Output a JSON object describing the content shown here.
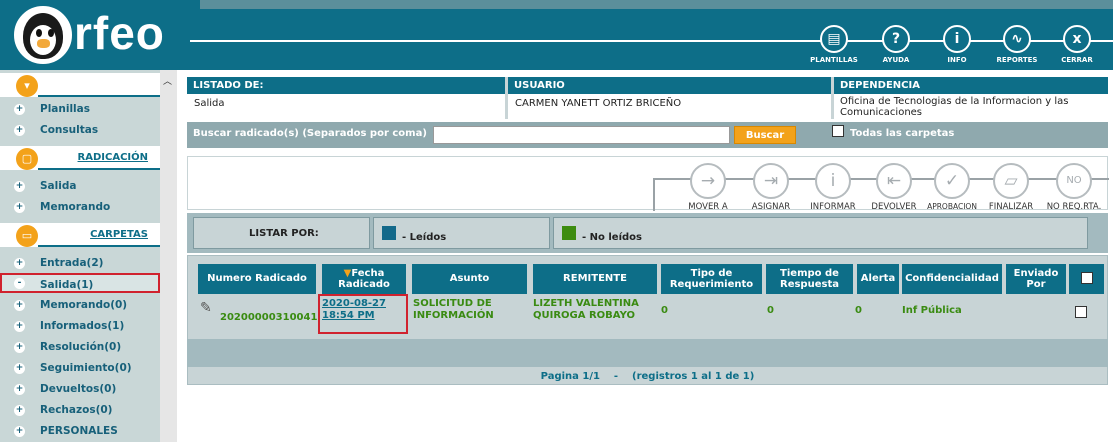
{
  "app": {
    "logo_text": "rfeo"
  },
  "header_buttons": [
    {
      "label": "PLANTILLAS",
      "glyph": "▤",
      "icon": "templates-icon"
    },
    {
      "label": "AYUDA",
      "glyph": "?",
      "icon": "help-icon"
    },
    {
      "label": "INFO",
      "glyph": "i",
      "icon": "info-icon"
    },
    {
      "label": "REPORTES",
      "glyph": "∿",
      "icon": "reports-icon"
    },
    {
      "label": "CERRAR",
      "glyph": "x",
      "icon": "close-icon"
    }
  ],
  "sidebar": {
    "top_items": [
      "Planillas",
      "Consultas"
    ],
    "radicacion_title": "RADICACIÓN",
    "radicacion_items": [
      "Salida",
      "Memorando"
    ],
    "carpetas_title": "CARPETAS",
    "carpetas_items": [
      {
        "label": "Entrada(2)",
        "sign": "+"
      },
      {
        "label": "Salida(1)",
        "sign": "-"
      },
      {
        "label": "Memorando(0)",
        "sign": "+"
      },
      {
        "label": "Informados(1)",
        "sign": "+"
      },
      {
        "label": "Resolución(0)",
        "sign": "+"
      },
      {
        "label": "Seguimiento(0)",
        "sign": "+"
      },
      {
        "label": "Devueltos(0)",
        "sign": "+"
      },
      {
        "label": "Rechazos(0)",
        "sign": "+"
      },
      {
        "label": "PERSONALES",
        "sign": "+"
      }
    ]
  },
  "info": {
    "listado_label": "LISTADO DE:",
    "listado_value": "Salida",
    "usuario_label": "USUARIO",
    "usuario_value": "CARMEN YANETT ORTIZ BRICEÑO",
    "dependencia_label": "DEPENDENCIA",
    "dependencia_value": "Oficina de Tecnologias de la Informacion y las Comunicaciones"
  },
  "search": {
    "label": "Buscar radicado(s) (Separados por coma)",
    "value": "",
    "button": "Buscar",
    "all_folders": "Todas las carpetas"
  },
  "actions": [
    {
      "label": "MOVER A",
      "glyph": "→",
      "icon": "move-icon"
    },
    {
      "label": "ASIGNAR",
      "glyph": "⇥",
      "icon": "assign-icon"
    },
    {
      "label": "INFORMAR",
      "glyph": "i",
      "icon": "inform-icon"
    },
    {
      "label": "DEVOLVER",
      "glyph": "⇤",
      "icon": "return-icon"
    },
    {
      "label": "APROBACION",
      "glyph": "✓",
      "icon": "approve-icon"
    },
    {
      "label": "FINALIZAR",
      "glyph": "▱",
      "icon": "finish-icon"
    },
    {
      "label": "NO REQ.RTA.",
      "glyph": "NO",
      "icon": "no-reply-icon"
    }
  ],
  "listar": {
    "label": "LISTAR POR:",
    "read": "- Leídos",
    "unread": "- No leídos",
    "read_color": "#13698a",
    "unread_color": "#3d8c10"
  },
  "table": {
    "headers": [
      "Numero Radicado",
      "Fecha Radicado",
      "Asunto",
      "REMITENTE",
      "Tipo de Requerimiento",
      "Tiempo de Respuesta",
      "Alerta",
      "Confidencialidad",
      "Enviado Por"
    ],
    "rows": [
      {
        "numero": "20200000310041",
        "fecha": "2020-08-27 18:54 PM",
        "asunto": "SOLICITUD DE INFORMACIÓN",
        "remitente": "LIZETH VALENTINA QUIROGA ROBAYO",
        "tipo": "0",
        "tiempo": "0",
        "alerta": "0",
        "confidencialidad": "Inf Pública",
        "enviado_por": ""
      }
    ]
  },
  "pager": {
    "page": "Pagina 1/1",
    "sep": "-",
    "records": "(registros 1 al 1 de 1)"
  }
}
